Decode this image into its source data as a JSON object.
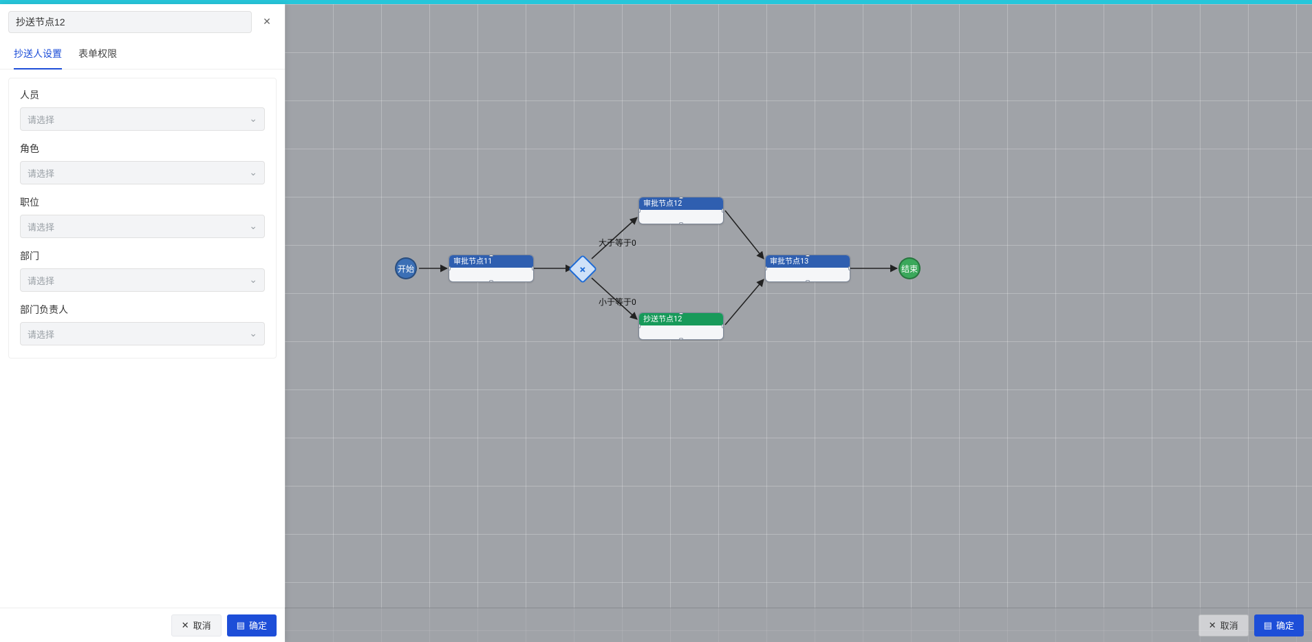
{
  "colors": {
    "primary": "#1d4ed8",
    "teal": "#26c6da",
    "nodeBlue": "#2f5fb0",
    "nodeGreen": "#189a5a"
  },
  "panel": {
    "title_value": "抄送节点12",
    "tabs": [
      {
        "label": "抄送人设置",
        "active": true
      },
      {
        "label": "表单权限",
        "active": false
      }
    ],
    "form": {
      "fields": [
        {
          "label": "人员",
          "placeholder": "请选择"
        },
        {
          "label": "角色",
          "placeholder": "请选择"
        },
        {
          "label": "职位",
          "placeholder": "请选择"
        },
        {
          "label": "部门",
          "placeholder": "请选择"
        },
        {
          "label": "部门负责人",
          "placeholder": "请选择"
        }
      ]
    },
    "footer": {
      "cancel": "取消",
      "confirm": "确定"
    }
  },
  "mainFooter": {
    "cancel": "取消",
    "confirm": "确定"
  },
  "flow": {
    "start_label": "开始",
    "end_label": "结束",
    "gateway_symbol": "×",
    "nodes": {
      "approve11": "审批节点11",
      "approve12": "审批节点12",
      "approve13": "审批节点13",
      "cc12": "抄送节点12"
    },
    "edgeLabels": {
      "gte0": "大于等于0",
      "lte0": "小于等于0"
    }
  }
}
